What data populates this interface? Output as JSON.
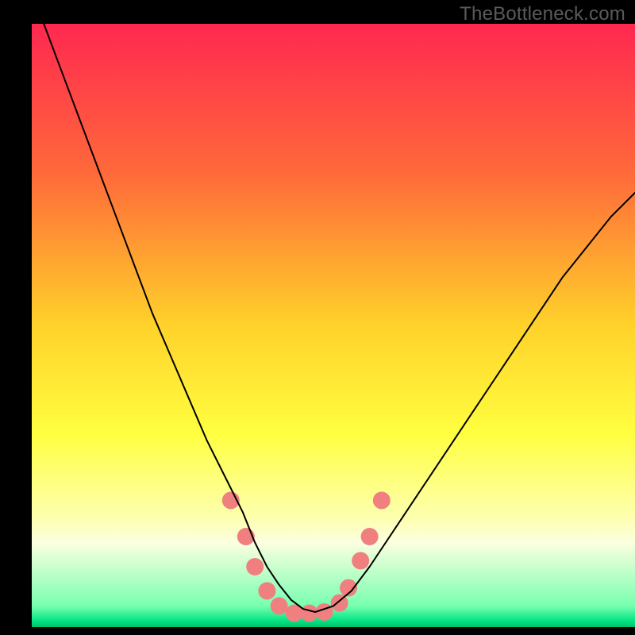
{
  "watermark": "TheBottleneck.com",
  "chart_data": {
    "type": "line",
    "title": "",
    "xlabel": "",
    "ylabel": "",
    "xlim": [
      0,
      100
    ],
    "ylim": [
      0,
      100
    ],
    "grid": false,
    "legend": false,
    "background_gradient_stops": [
      {
        "offset": 0,
        "color": "#ff2850"
      },
      {
        "offset": 0.25,
        "color": "#ff6a3a"
      },
      {
        "offset": 0.5,
        "color": "#ffd22a"
      },
      {
        "offset": 0.68,
        "color": "#ffff40"
      },
      {
        "offset": 0.82,
        "color": "#fdffb0"
      },
      {
        "offset": 0.86,
        "color": "#fcffe0"
      },
      {
        "offset": 0.965,
        "color": "#78ffb0"
      },
      {
        "offset": 0.99,
        "color": "#00e482"
      },
      {
        "offset": 1.0,
        "color": "#00c06a"
      }
    ],
    "series": [
      {
        "name": "bottleneck-curve",
        "stroke": "#000000",
        "stroke_width": 2,
        "x": [
          2,
          5,
          8,
          11,
          14,
          17,
          20,
          23,
          26,
          29,
          32,
          35,
          37,
          39,
          41,
          43,
          45,
          47,
          50,
          53,
          56,
          60,
          64,
          68,
          72,
          76,
          80,
          84,
          88,
          92,
          96,
          100
        ],
        "y": [
          100,
          92,
          84,
          76,
          68,
          60,
          52,
          45,
          38,
          31,
          25,
          19,
          14,
          10,
          7,
          4.5,
          3,
          2.5,
          3.5,
          6,
          10,
          16,
          22,
          28,
          34,
          40,
          46,
          52,
          58,
          63,
          68,
          72
        ]
      }
    ],
    "marker_cluster": {
      "name": "highlighted-points",
      "color": "#f08080",
      "radius": 11,
      "points": [
        {
          "x": 33,
          "y": 21
        },
        {
          "x": 35.5,
          "y": 15
        },
        {
          "x": 37,
          "y": 10
        },
        {
          "x": 39,
          "y": 6
        },
        {
          "x": 41,
          "y": 3.5
        },
        {
          "x": 43.5,
          "y": 2.3
        },
        {
          "x": 46,
          "y": 2.3
        },
        {
          "x": 48.5,
          "y": 2.5
        },
        {
          "x": 51,
          "y": 4
        },
        {
          "x": 52.5,
          "y": 6.5
        },
        {
          "x": 54.5,
          "y": 11
        },
        {
          "x": 56,
          "y": 15
        },
        {
          "x": 58,
          "y": 21
        }
      ]
    }
  }
}
